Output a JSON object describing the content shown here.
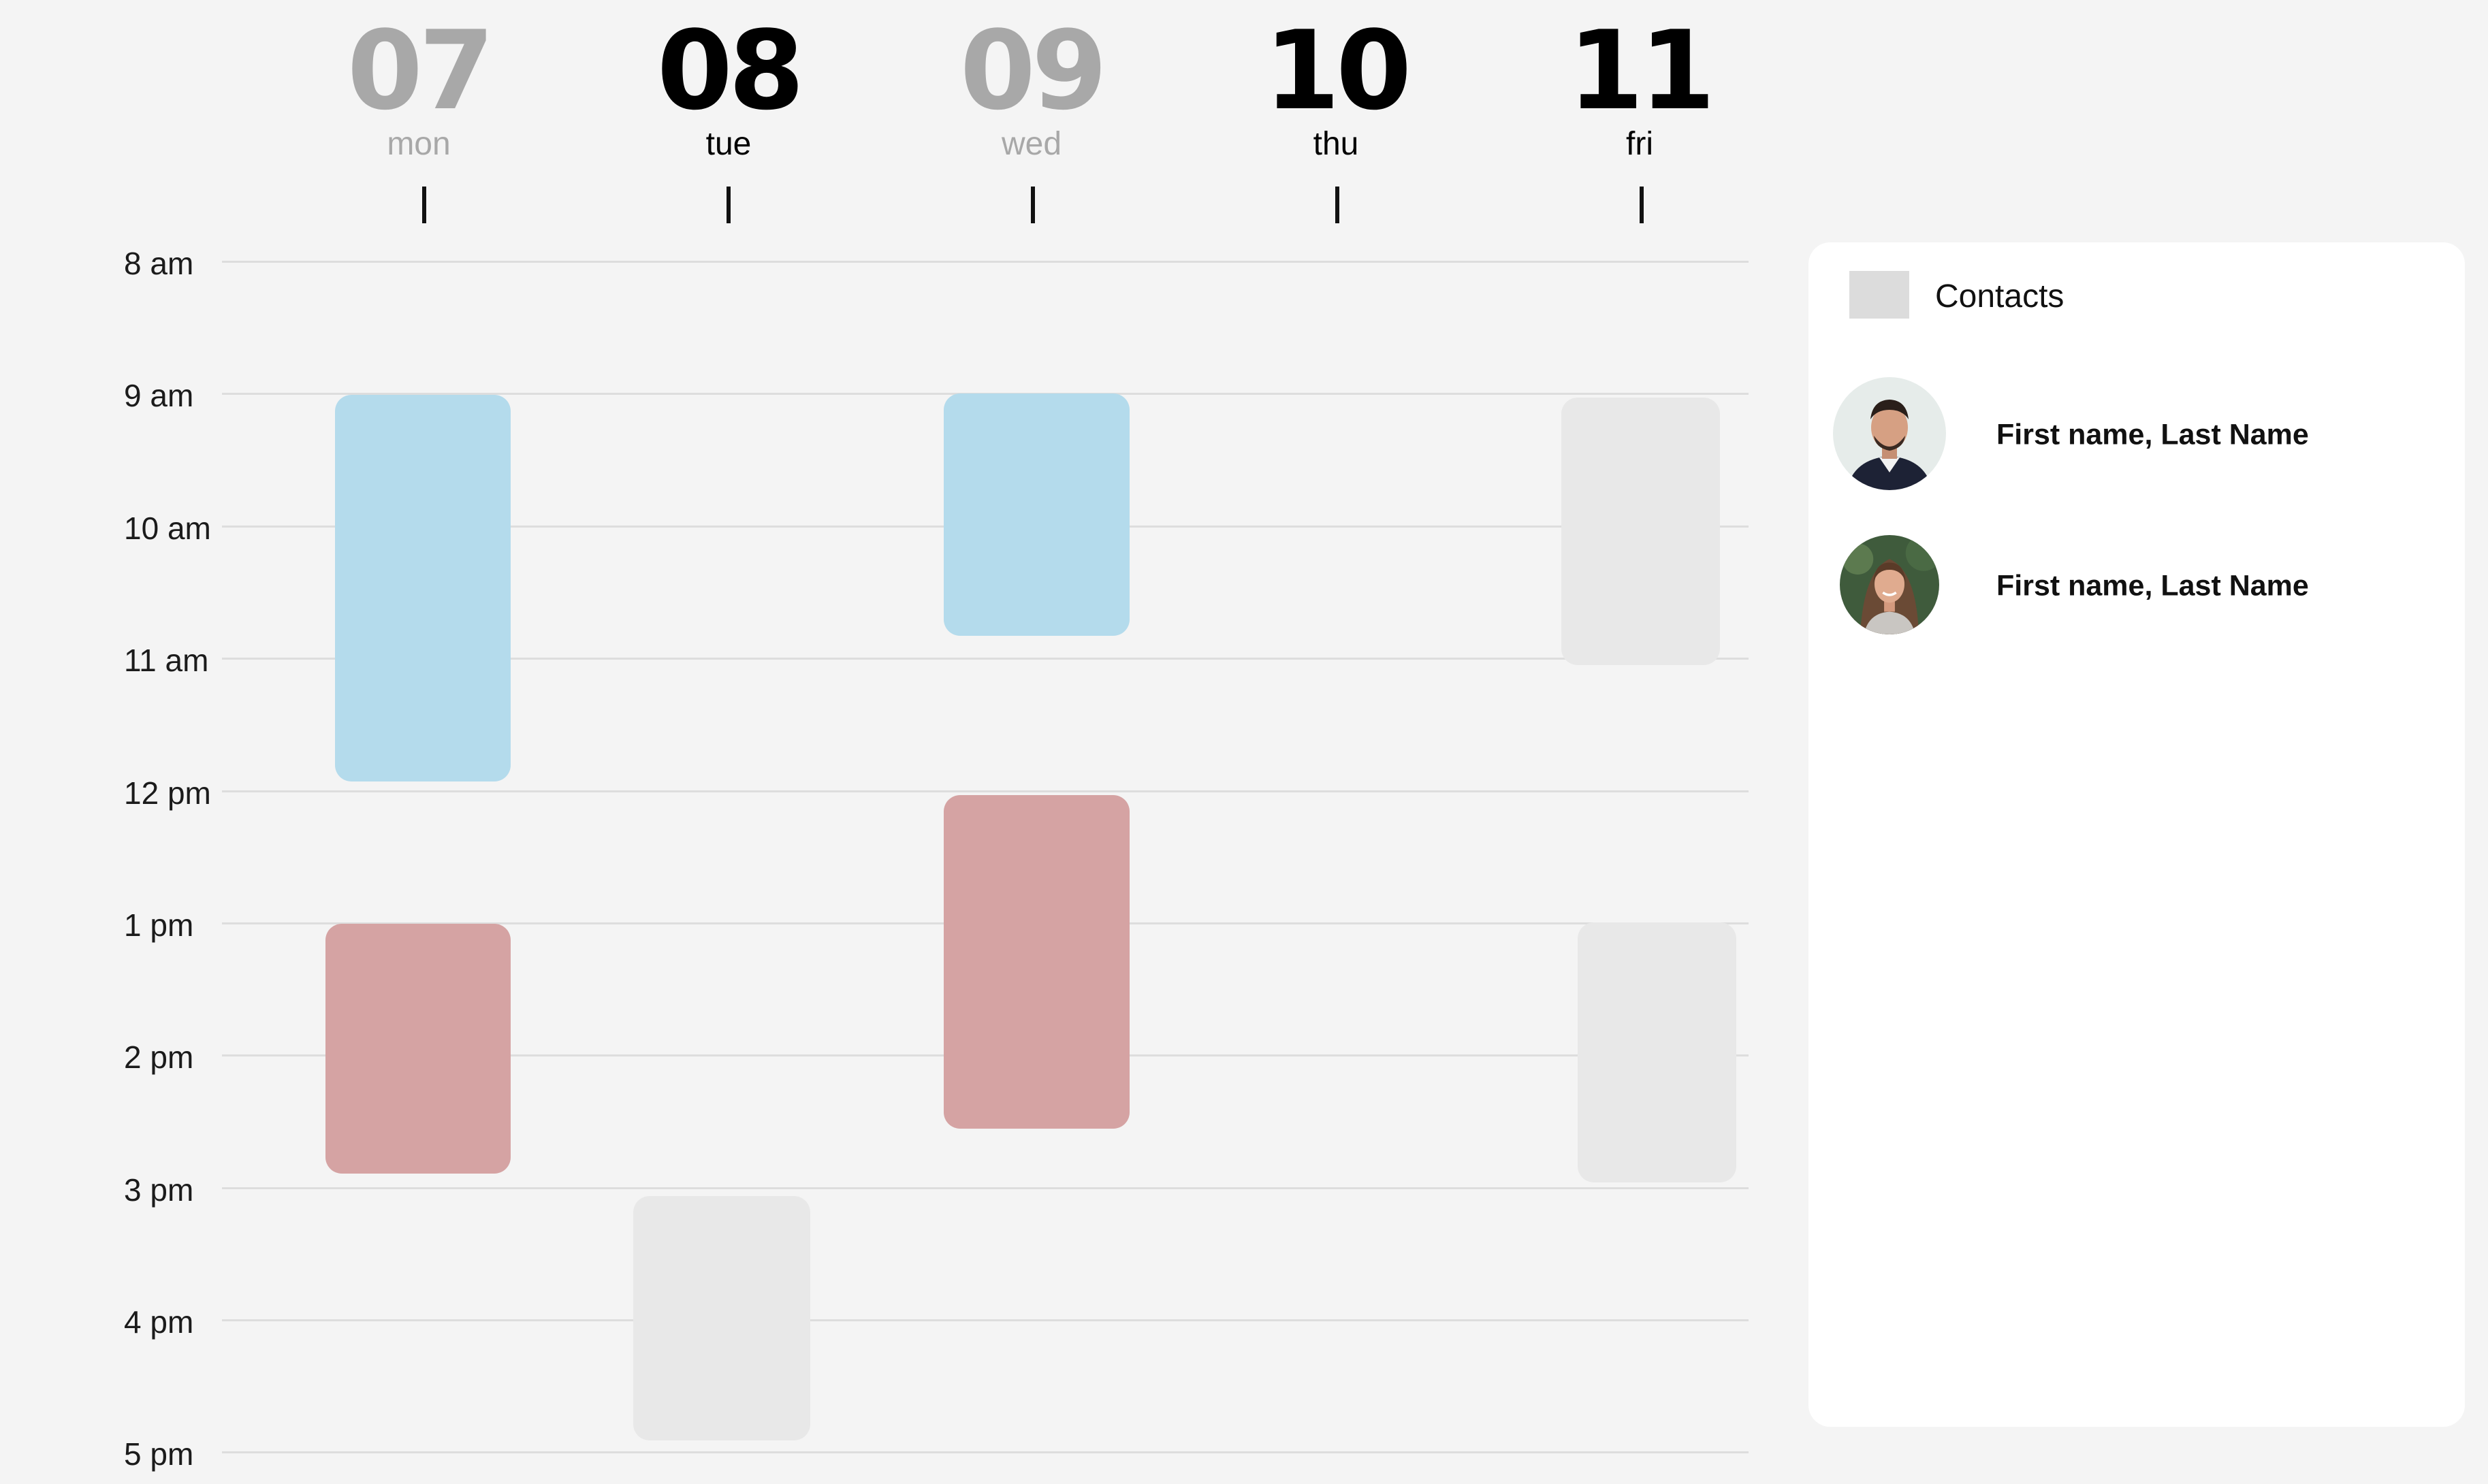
{
  "calendar": {
    "days": [
      {
        "number": "07",
        "name": "mon",
        "state": "muted"
      },
      {
        "number": "08",
        "name": "tue",
        "state": "active"
      },
      {
        "number": "09",
        "name": "wed",
        "state": "muted"
      },
      {
        "number": "10",
        "name": "thu",
        "state": "active"
      },
      {
        "number": "11",
        "name": "fri",
        "state": "active"
      }
    ],
    "hours": [
      "8 am",
      "9 am",
      "10 am",
      "11 am",
      "12 pm",
      "1 pm",
      "2 pm",
      "3 pm",
      "4 pm",
      "5 pm"
    ],
    "events": [
      {
        "day": "mon",
        "start": "9:00",
        "end": "12:00",
        "color": "#b4dbec"
      },
      {
        "day": "mon",
        "start": "13:00",
        "end": "15:00",
        "color": "#d5a3a3"
      },
      {
        "day": "tue",
        "start": "15:00",
        "end": "17:00",
        "color": "#e8e8e8"
      },
      {
        "day": "wed",
        "start": "9:00",
        "end": "11:00",
        "color": "#b4dbec"
      },
      {
        "day": "wed",
        "start": "12:00",
        "end": "14:30",
        "color": "#d5a3a3"
      },
      {
        "day": "fri",
        "start": "9:00",
        "end": "11:00",
        "color": "#e8e8e8"
      },
      {
        "day": "fri",
        "start": "13:00",
        "end": "15:00",
        "color": "#e8e8e8"
      }
    ]
  },
  "contacts": {
    "title": "Contacts",
    "items": [
      {
        "name": "First name, Last Name",
        "avatar": "avatar-man-icon"
      },
      {
        "name": "First name, Last Name",
        "avatar": "avatar-woman-icon"
      }
    ]
  },
  "colors": {
    "background": "#f4f4f4",
    "event_blue": "#b4dbec",
    "event_red": "#d5a3a3",
    "event_grey": "#e8e8e8",
    "muted_text": "#a8a8a8"
  }
}
